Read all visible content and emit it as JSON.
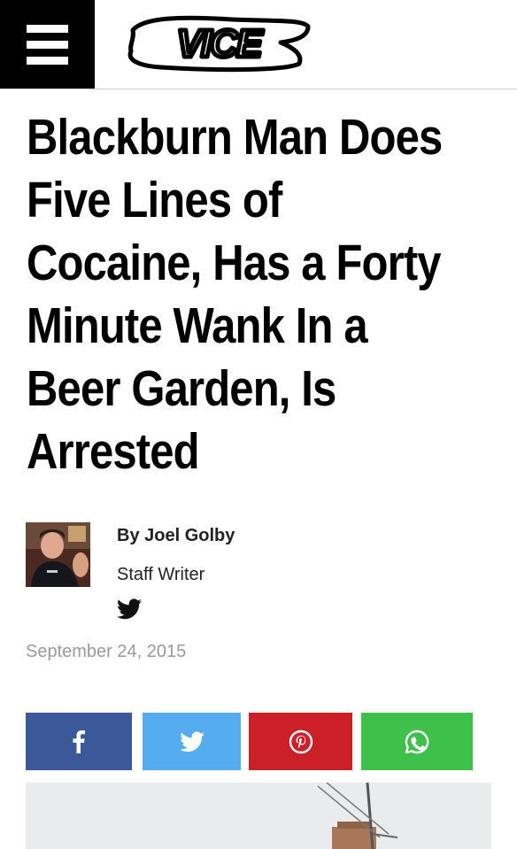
{
  "header": {
    "logo_text": "VICE",
    "menu_icon": "hamburger-menu-icon"
  },
  "article": {
    "headline_lines": [
      "Blackburn Man Does",
      "Five Lines of",
      "Cocaine, Has a Forty",
      "Minute Wank In a",
      "Beer Garden, Is",
      "Arrested"
    ],
    "byline": "By Joel Golby",
    "role": "Staff Writer",
    "twitter_icon": "twitter-bird-icon",
    "date": "September 24, 2015"
  },
  "share": [
    {
      "network": "facebook",
      "icon": "facebook-icon",
      "color": "#3b5998"
    },
    {
      "network": "twitter",
      "icon": "twitter-icon",
      "color": "#55acee"
    },
    {
      "network": "pinterest",
      "icon": "pinterest-icon",
      "color": "#cb2027"
    },
    {
      "network": "whatsapp",
      "icon": "whatsapp-icon",
      "color": "#3fc04a"
    }
  ],
  "colors": {
    "header_menu_bg": "#000000",
    "date_text": "#9a9a9a"
  }
}
